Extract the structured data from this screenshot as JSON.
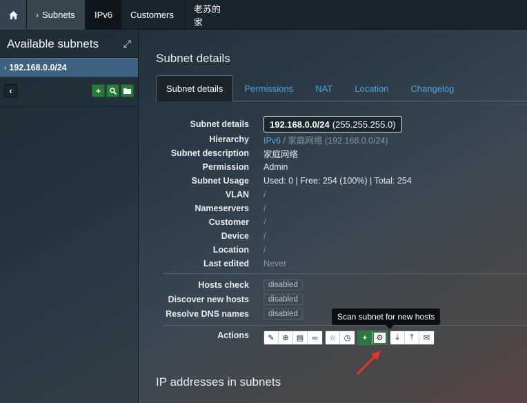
{
  "nav": {
    "home_icon": "home-icon",
    "subnets": "Subnets",
    "ipv6": "IPv6",
    "customers": "Customers",
    "chinese": "老苏的家"
  },
  "sidebar": {
    "title": "Available subnets",
    "subnet": "192.168.0.0/24"
  },
  "main": {
    "title": "Subnet details",
    "tabs": [
      "Subnet details",
      "Permissions",
      "NAT",
      "Location",
      "Changelog"
    ],
    "rows": {
      "subnet_details": {
        "label": "Subnet details",
        "value_bold": "192.168.0.0/24",
        "value_rest": "(255.255.255.0)"
      },
      "hierarchy": {
        "label": "Hierarchy",
        "link": "IPv6",
        "sep": "/",
        "rest": "家庭网络 (192.168.0.0/24)"
      },
      "description": {
        "label": "Subnet description",
        "value": "家庭网络"
      },
      "permission": {
        "label": "Permission",
        "value": "Admin"
      },
      "usage": {
        "label": "Subnet Usage",
        "value": "Used: 0 | Free: 254 (100%) | Total: 254"
      },
      "vlan": {
        "label": "VLAN",
        "value": "/"
      },
      "nameservers": {
        "label": "Nameservers",
        "value": "/"
      },
      "customer": {
        "label": "Customer",
        "value": "/"
      },
      "device": {
        "label": "Device",
        "value": "/"
      },
      "location": {
        "label": "Location",
        "value": "/"
      },
      "last_edited": {
        "label": "Last edited",
        "value": "Never"
      }
    },
    "checks": {
      "hosts_check": {
        "label": "Hosts check",
        "value": "disabled"
      },
      "discover": {
        "label": "Discover new hosts",
        "value": "disabled"
      },
      "resolve": {
        "label": "Resolve DNS names",
        "value": "disabled"
      }
    },
    "actions_label": "Actions",
    "tooltip": "Scan subnet for new hosts",
    "bottom_title": "IP addresses in subnets"
  },
  "colors": {
    "accent": "#4fa3e0",
    "green": "#2b7a3d",
    "selected_row": "#3d6180",
    "arrow": "#e8332a"
  }
}
